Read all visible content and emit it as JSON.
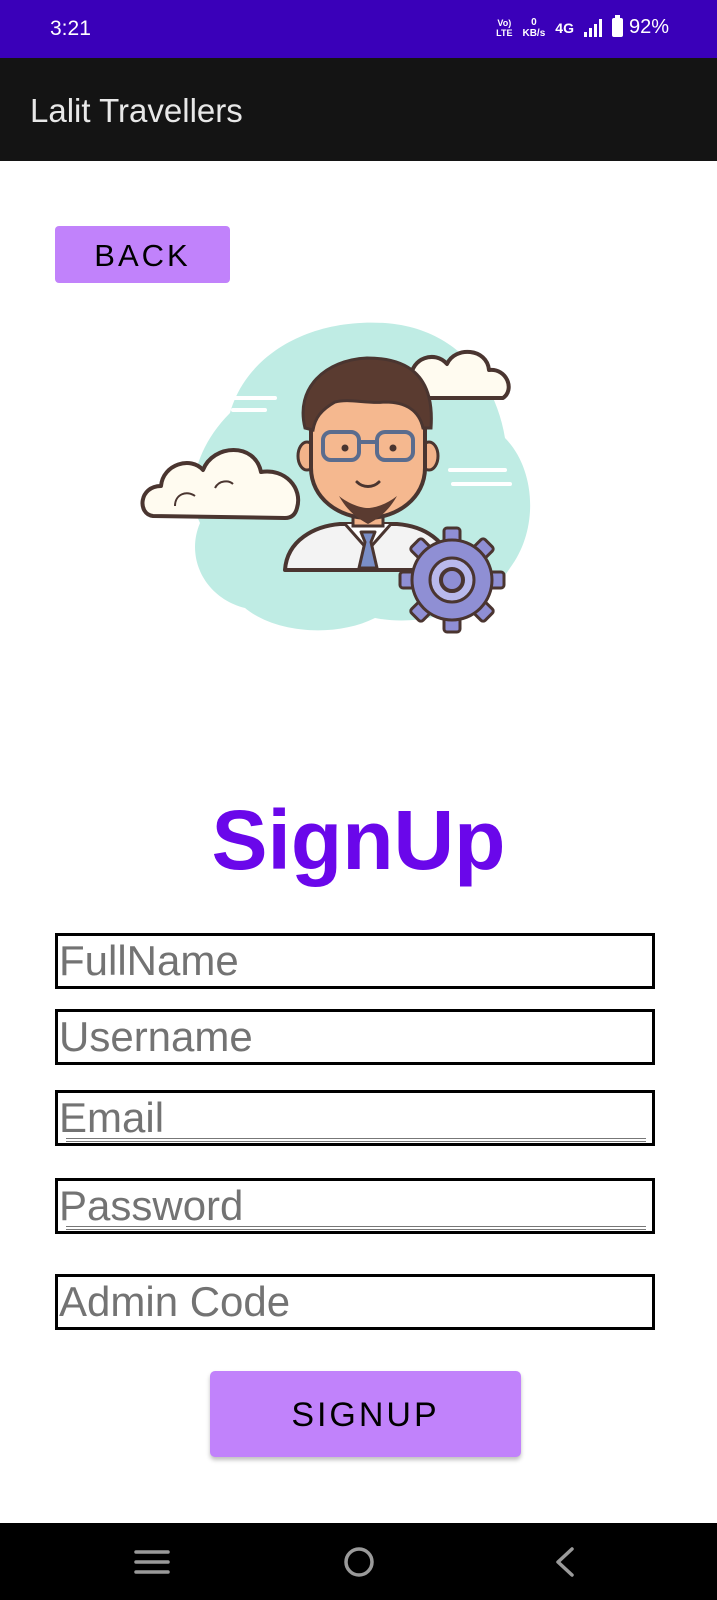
{
  "status_bar": {
    "time": "3:21",
    "volte_top": "Vo)",
    "volte_bottom": "LTE",
    "speed_value": "0",
    "speed_unit": "KB/s",
    "network": "4G",
    "battery": "92%"
  },
  "app_bar": {
    "title": "Lalit Travellers"
  },
  "back_button": {
    "label": "BACK"
  },
  "page_title": "SignUp",
  "form": {
    "fullname_placeholder": "FullName",
    "username_placeholder": "Username",
    "email_placeholder": "Email",
    "password_placeholder": "Password",
    "admin_code_placeholder": "Admin Code"
  },
  "signup_button": {
    "label": "SIGNUP"
  },
  "nav_bar": {
    "icons": [
      "menu-icon",
      "home-icon",
      "back-icon"
    ]
  },
  "colors": {
    "status_bar": "#3a00b9",
    "app_bar": "#141414",
    "button": "#c182fb",
    "title": "#6a07ea"
  }
}
